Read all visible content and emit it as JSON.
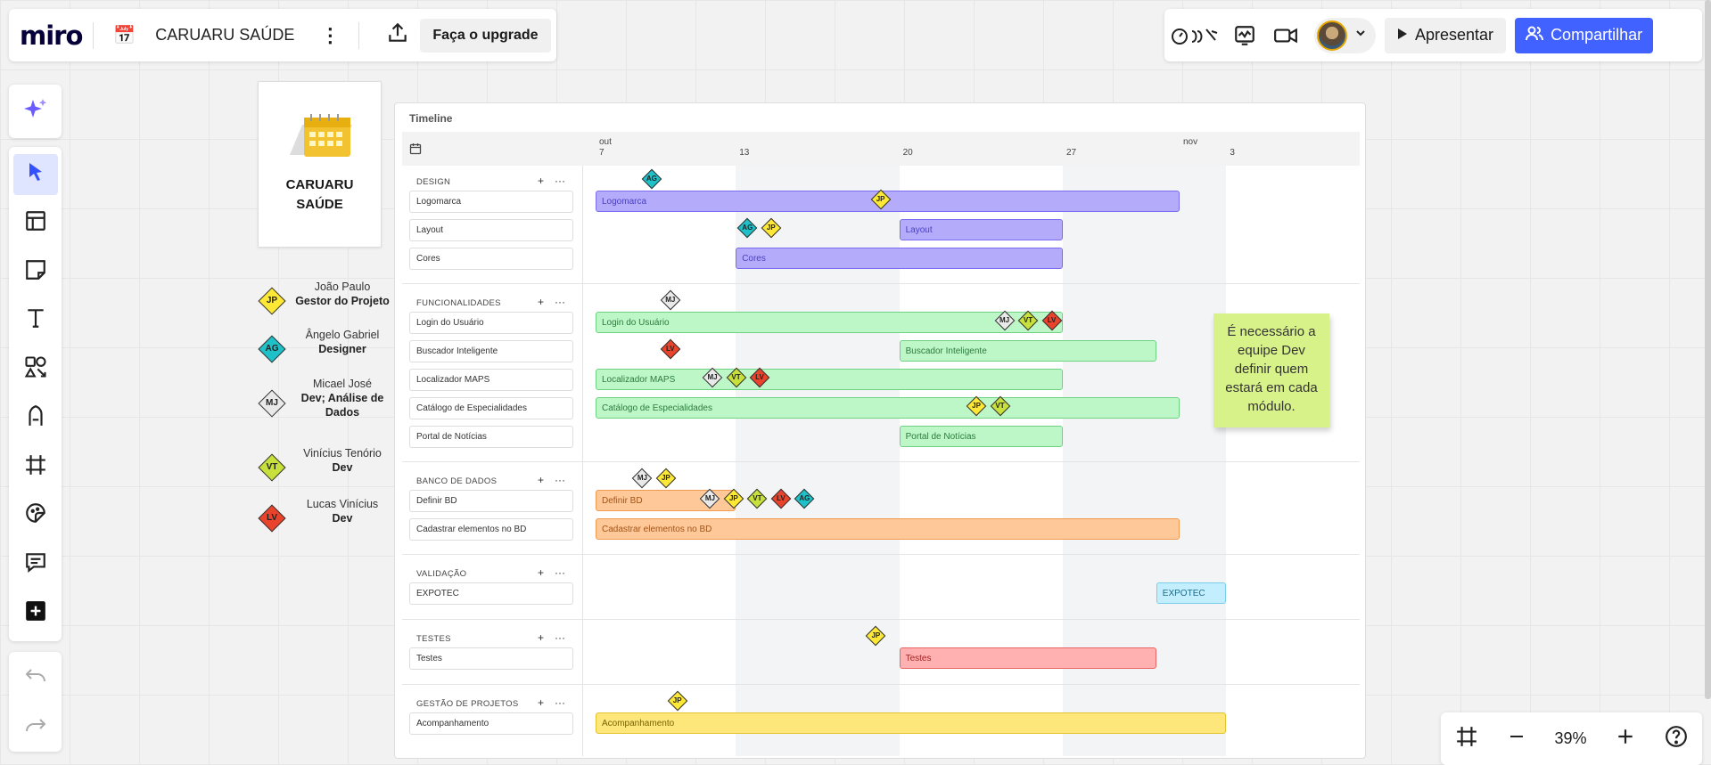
{
  "header": {
    "logo": "miro",
    "board_name": "CARUARU SAÚDE",
    "upgrade_label": "Faça o upgrade",
    "present_label": "Apresentar",
    "share_label": "Compartilhar"
  },
  "zoom": {
    "value": "39%"
  },
  "title_card": {
    "line1": "CARUARU",
    "line2": "SAÚDE"
  },
  "legend": [
    {
      "code": "JP",
      "name": "João Paulo",
      "role": "Gestor do Projeto",
      "color": "#fde836"
    },
    {
      "code": "AG",
      "name": "Ângelo Gabriel",
      "role": "Designer",
      "color": "#1fc0c8"
    },
    {
      "code": "MJ",
      "name": "Micael José",
      "role": "Dev; Análise de Dados",
      "color": "#e9e9e9"
    },
    {
      "code": "VT",
      "name": "Vinícius Tenório",
      "role": "Dev",
      "color": "#c7e03b"
    },
    {
      "code": "LV",
      "name": "Lucas Vinícius",
      "role": "Dev",
      "color": "#e9442b"
    }
  ],
  "timeline": {
    "title": "Timeline",
    "months": [
      {
        "label": "out",
        "day_index": 0
      },
      {
        "label": "nov",
        "day_index": 25
      }
    ],
    "days": [
      {
        "label": "7",
        "day_index": 0
      },
      {
        "label": "13",
        "day_index": 6
      },
      {
        "label": "20",
        "day_index": 13
      },
      {
        "label": "27",
        "day_index": 20
      },
      {
        "label": "3",
        "day_index": 27
      }
    ],
    "groups": [
      {
        "name": "DESIGN",
        "rows": [
          {
            "label": "Logomarca",
            "bar": "Logomarca",
            "start": 0,
            "end": 25,
            "color": "purple"
          },
          {
            "label": "Layout",
            "bar": "Layout",
            "start": 13,
            "end": 20,
            "color": "purple"
          },
          {
            "label": "Cores",
            "bar": "Cores",
            "start": 6,
            "end": 20,
            "color": "purple"
          }
        ]
      },
      {
        "name": "FUNCIONALIDADES",
        "rows": [
          {
            "label": "Login do Usuário",
            "bar": "Login do Usuário",
            "start": 0,
            "end": 20,
            "color": "green"
          },
          {
            "label": "Buscador Inteligente",
            "bar": "Buscador Inteligente",
            "start": 13,
            "end": 24,
            "color": "green"
          },
          {
            "label": "Localizador MAPS",
            "bar": "Localizador MAPS",
            "start": 0,
            "end": 20,
            "color": "green"
          },
          {
            "label": "Catálogo de Especialidades",
            "bar": "Catálogo de Especialidades",
            "start": 0,
            "end": 25,
            "color": "green"
          },
          {
            "label": "Portal de Notícias",
            "bar": "Portal de Notícias",
            "start": 13,
            "end": 20,
            "color": "green"
          }
        ]
      },
      {
        "name": "BANCO DE DADOS",
        "rows": [
          {
            "label": "Definir BD",
            "bar": "Definir BD",
            "start": 0,
            "end": 6,
            "color": "orange"
          },
          {
            "label": "Cadastrar elementos no BD",
            "bar": "Cadastrar elementos no BD",
            "start": 0,
            "end": 25,
            "color": "orange"
          }
        ]
      },
      {
        "name": "VALIDAÇÃO",
        "rows": [
          {
            "label": "EXPOTEC",
            "bar": "EXPOTEC",
            "start": 24,
            "end": 27,
            "color": "cyan"
          }
        ]
      },
      {
        "name": "TESTES",
        "rows": [
          {
            "label": "Testes",
            "bar": "Testes",
            "start": 13,
            "end": 24,
            "color": "red"
          }
        ]
      },
      {
        "name": "GESTÃO DE PROJETOS",
        "rows": [
          {
            "label": "Acompanhamento",
            "bar": "Acompanhamento",
            "start": 0,
            "end": 27,
            "color": "yellow"
          }
        ]
      }
    ],
    "group_controls": {
      "add": "+",
      "more": "···"
    }
  },
  "sticky_note": {
    "text": "É necessário a equipe Dev definir quem estará em cada módulo."
  },
  "colors": {
    "accent": "#4262ff",
    "jp": "#fde836",
    "ag": "#1fc0c8",
    "mj": "#e9e9e9",
    "vt": "#c7e03b",
    "lv": "#e9442b"
  }
}
